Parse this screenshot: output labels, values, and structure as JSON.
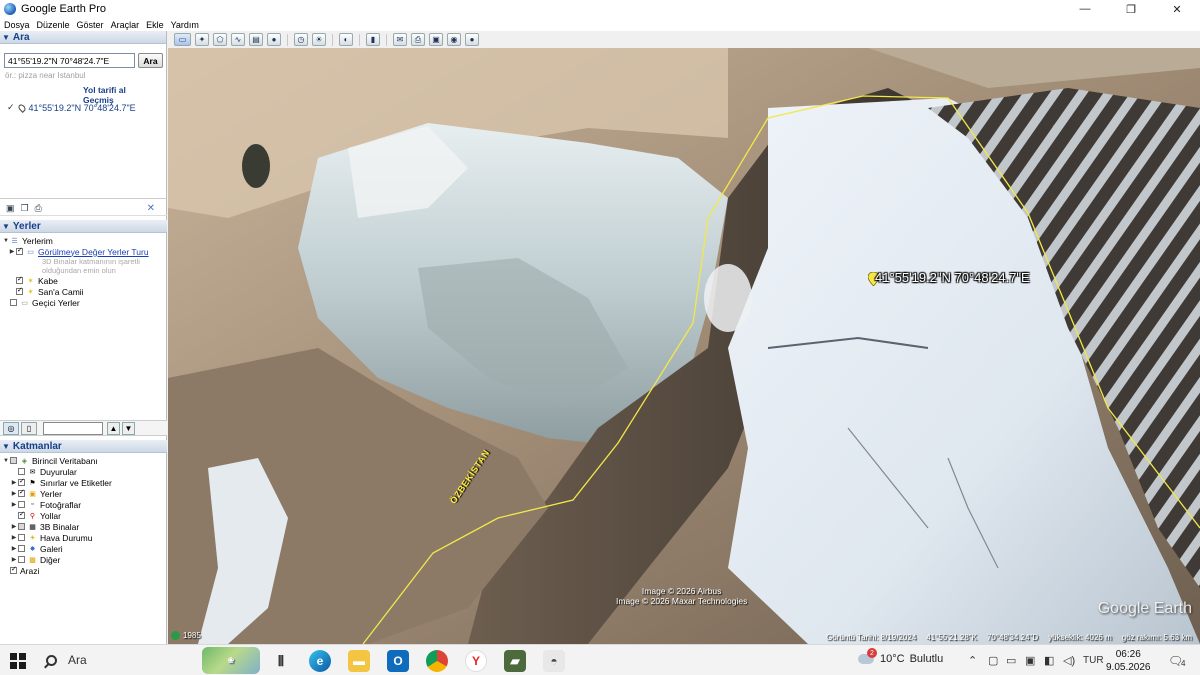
{
  "window": {
    "title": "Google Earth Pro",
    "minimize": "—",
    "maximize": "❐",
    "close": "✕"
  },
  "menu": [
    "Dosya",
    "Düzenle",
    "Göster",
    "Araçlar",
    "Ekle",
    "Yardım"
  ],
  "search": {
    "header": "Ara",
    "value": "41°55'19.2\"N 70°48'24.7\"E",
    "button": "Ara",
    "hint": "ör.: pizza near Istanbul",
    "directions_link": "Yol tarifi al",
    "history_link": "Geçmiş",
    "result": "41°55'19.2\"N 70°48'24.7\"E"
  },
  "places": {
    "header": "Yerler",
    "root": "Yerlerim",
    "tour": "Görülmeye Değer Yerler Turu",
    "tour_note_1": "3D Binalar katmanının işaretli",
    "tour_note_2": "olduğundan emin olun",
    "item1": "Kabe",
    "item2": "San'a Camii",
    "temp": "Geçici Yerler"
  },
  "layers": {
    "header": "Katmanlar",
    "root": "Birincil Veritabanı",
    "items": [
      "Duyurular",
      "Sınırlar ve Etiketler",
      "Yerler",
      "Fotoğraflar",
      "Yollar",
      "3B Binalar",
      "Hava Durumu",
      "Galeri",
      "Diğer",
      "Arazi"
    ]
  },
  "map": {
    "placemark_label": "41°55'19.2\"N 70°48'24.7\"E",
    "country_label": "ÖZBEKİSTAN",
    "credit1": "Image © 2026 Airbus",
    "credit2": "Image © 2026 Maxar Technologies",
    "logo": "Google Earth",
    "history_year": "1985",
    "status_date": "Görüntü Tarihi: 8/19/2024",
    "status_lat": "41°55'21.28\"K",
    "status_lon": "70°48'34.24\"D",
    "status_elev": "yükseklik: 4026 m",
    "status_eye": "göz rakımı: 5.63 km"
  },
  "taskbar": {
    "search_label": "Ara",
    "weather_temp": "10°C",
    "weather_text": "Bulutlu",
    "weather_badge": "2",
    "lang": "TUR",
    "time": "06:26",
    "date": "9.05.2026",
    "notif_count": "4"
  },
  "colors": {
    "accent": "#173f8a",
    "boundary": "#f2e84a",
    "link": "#1a3fb5"
  }
}
